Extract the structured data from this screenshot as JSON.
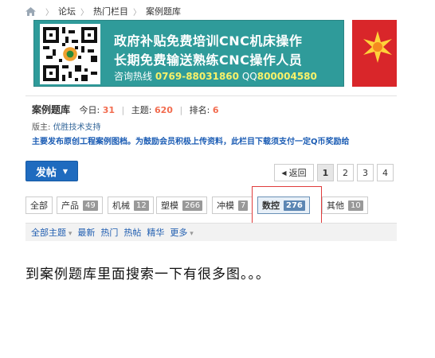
{
  "breadcrumb": {
    "items": [
      "论坛",
      "热门栏目",
      "案例题库"
    ]
  },
  "banner": {
    "line1": "政府补贴免费培训CNC机床操作",
    "line2": "长期免费输送熟练CNC操作人员",
    "line3_prefix": "咨询热线 ",
    "line3_phone": "0769-88031860",
    "line3_mid": " QQ",
    "line3_qq": "800004580"
  },
  "forum": {
    "title": "案例题库",
    "today_label": "今日:",
    "today_count": "31",
    "topics_label": "主题:",
    "topics_count": "620",
    "rank_label": "排名:",
    "rank_value": "6",
    "moderator_label": "版主:",
    "moderator_name": "优胜技术支持",
    "notice": "主要发布原创工程案例图档。为鼓励会员积极上传资料，此栏目下载须支付一定Q币奖励给"
  },
  "toolbar": {
    "post_label": "发帖",
    "back_label": "返回",
    "pages": [
      "1",
      "2",
      "3",
      "4"
    ]
  },
  "type_tabs": [
    {
      "label": "全部",
      "count": ""
    },
    {
      "label": "产品",
      "count": "49"
    },
    {
      "label": "机械",
      "count": "12"
    },
    {
      "label": "塑模",
      "count": "266"
    },
    {
      "label": "冲模",
      "count": "7"
    },
    {
      "label": "数控",
      "count": "276"
    },
    {
      "label": "其他",
      "count": "10"
    }
  ],
  "filter": {
    "all_topics": "全部主题",
    "latest": "最新",
    "hot": "热门",
    "hotspot": "热帖",
    "digest": "精华",
    "more": "更多"
  },
  "caption": "到案例题库里面搜索一下有很多图。。。",
  "colors": {
    "banner_bg": "#2f9b9a",
    "accent_blue": "#1f6bbf",
    "highlight_red": "#e03c3c",
    "count_orange": "#f26c4f"
  }
}
